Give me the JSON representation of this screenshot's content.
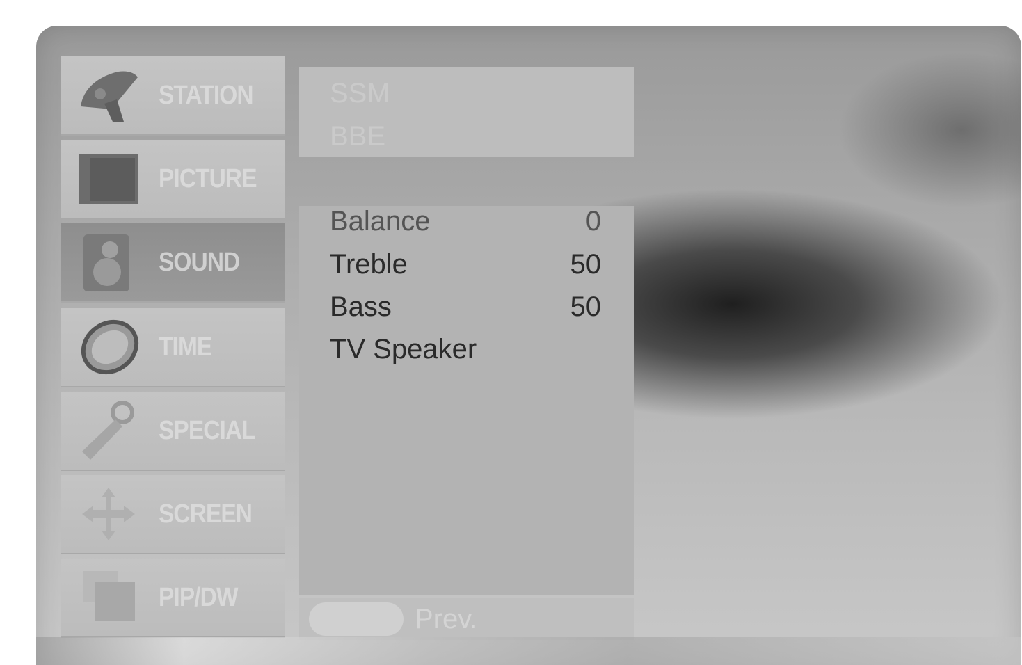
{
  "menu": {
    "items": [
      {
        "label": "STATION",
        "icon": "satellite-dish-icon"
      },
      {
        "label": "PICTURE",
        "icon": "picture-icon"
      },
      {
        "label": "SOUND",
        "icon": "speaker-icon",
        "active": true
      },
      {
        "label": "TIME",
        "icon": "clock-icon"
      },
      {
        "label": "SPECIAL",
        "icon": "key-icon"
      },
      {
        "label": "SCREEN",
        "icon": "move-arrows-icon"
      },
      {
        "label": "PIP/DW",
        "icon": "pip-windows-icon"
      }
    ]
  },
  "sound_top": {
    "items": [
      "SSM",
      "BBE"
    ]
  },
  "sound_sub": {
    "rows": [
      {
        "label": "Balance",
        "value": "0"
      },
      {
        "label": "Treble",
        "value": "50"
      },
      {
        "label": "Bass",
        "value": "50"
      },
      {
        "label": "TV Speaker",
        "value": ""
      }
    ]
  },
  "footer": {
    "prev_label": "Prev."
  }
}
